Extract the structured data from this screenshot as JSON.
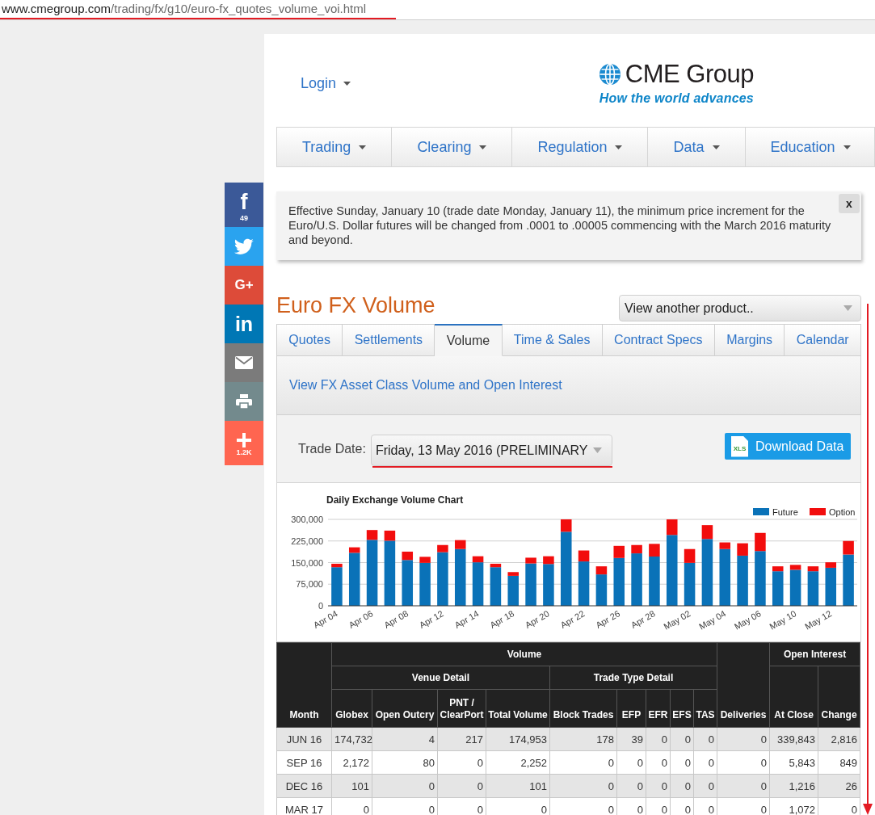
{
  "browser": {
    "url_domain": "www.cmegroup.com",
    "url_path": "/trading/fx/g10/euro-fx_quotes_volume_voi.html"
  },
  "social": [
    {
      "kind": "facebook",
      "glyph": "f",
      "count": "49"
    },
    {
      "kind": "twitter"
    },
    {
      "kind": "google_plus",
      "glyph": "G+"
    },
    {
      "kind": "linkedin",
      "glyph": "in"
    },
    {
      "kind": "email"
    },
    {
      "kind": "print"
    },
    {
      "kind": "share",
      "count": "1.2K"
    }
  ],
  "header": {
    "login": "Login",
    "logo_name": "CME Group",
    "tagline": "How the world advances"
  },
  "nav": [
    {
      "label": "Trading"
    },
    {
      "label": "Clearing"
    },
    {
      "label": "Regulation"
    },
    {
      "label": "Data"
    },
    {
      "label": "Education"
    }
  ],
  "notice": {
    "text": "Effective Sunday, January 10 (trade date Monday, January 11), the minimum price increment for the Euro/U.S. Dollar futures will be changed from .0001 to .00005 commencing with the March 2016 maturity and beyond.",
    "close": "x"
  },
  "product": {
    "title": "Euro FX Volume",
    "selector": "View another product.."
  },
  "tabs": [
    {
      "label": "Quotes",
      "selected": false
    },
    {
      "label": "Settlements",
      "selected": false
    },
    {
      "label": "Volume",
      "selected": true
    },
    {
      "label": "Time & Sales",
      "selected": false
    },
    {
      "label": "Contract Specs",
      "selected": false
    },
    {
      "label": "Margins",
      "selected": false
    },
    {
      "label": "Calendar",
      "selected": false
    }
  ],
  "volume_link": "View FX Asset Class Volume and Open Interest",
  "trade_date": {
    "label": "Trade Date:",
    "value": "Friday, 13 May 2016 (PRELIMINARY"
  },
  "download": {
    "label": "Download Data",
    "file_type": "XLS"
  },
  "chart": {
    "chart_data": {
      "type": "bar",
      "title": "Daily Exchange Volume Chart",
      "stacked": true,
      "grid": true,
      "legend": true,
      "ylim": [
        0,
        300000
      ],
      "yticks": [
        {
          "value": 0,
          "label": "0"
        },
        {
          "value": 75000,
          "label": "75,000"
        },
        {
          "value": 150000,
          "label": "150,000"
        },
        {
          "value": 225000,
          "label": "225,000"
        },
        {
          "value": 300000,
          "label": "300,000"
        }
      ],
      "categories": [
        "Apr 04",
        null,
        "Apr 06",
        null,
        "Apr 08",
        null,
        "Apr 12",
        null,
        "Apr 14",
        null,
        "Apr 18",
        null,
        "Apr 20",
        null,
        "Apr 22",
        null,
        "Apr 26",
        null,
        "Apr 28",
        null,
        "May 02",
        null,
        "May 04",
        null,
        "May 06",
        null,
        "May 10",
        null,
        "May 12",
        null
      ],
      "series": [
        {
          "name": "Future",
          "color": "#0a72b8",
          "values": [
            134000,
            184000,
            229000,
            226000,
            159000,
            149000,
            186000,
            197000,
            151000,
            134000,
            104000,
            147000,
            145000,
            257000,
            154000,
            109000,
            166000,
            182000,
            171000,
            246000,
            149000,
            232000,
            197000,
            174000,
            190000,
            120000,
            125000,
            120000,
            132000,
            178000
          ]
        },
        {
          "name": "Option",
          "color": "#f20d0d",
          "values": [
            12000,
            19000,
            34000,
            35000,
            29000,
            21000,
            25000,
            31000,
            21000,
            12000,
            13000,
            20000,
            27000,
            43000,
            38000,
            28000,
            42000,
            29000,
            44000,
            54000,
            48000,
            48000,
            23000,
            43000,
            63000,
            17000,
            17000,
            17000,
            19000,
            47000
          ]
        }
      ]
    }
  },
  "table": {
    "columns": [
      {
        "label": "Month"
      },
      {
        "label": "Volume",
        "children": [
          {
            "label": "Venue Detail",
            "children": [
              {
                "label": "Globex"
              },
              {
                "label": "Open Outcry"
              },
              {
                "label": "PNT / ClearPort"
              },
              {
                "label": "Total Volume"
              }
            ]
          },
          {
            "label": "Trade Type Detail",
            "children": [
              {
                "label": "Block Trades"
              },
              {
                "label": "EFP"
              },
              {
                "label": "EFR"
              },
              {
                "label": "EFS"
              },
              {
                "label": "TAS"
              }
            ]
          }
        ]
      },
      {
        "label": "Deliveries"
      },
      {
        "label": "Open Interest",
        "children": [
          {
            "label": "At Close"
          },
          {
            "label": "Change"
          }
        ]
      }
    ],
    "rows": [
      {
        "month": "JUN 16",
        "values": [
          "174,732",
          "4",
          "217",
          "174,953",
          "178",
          "39",
          "0",
          "0",
          "0",
          "0",
          "339,843",
          "2,816"
        ]
      },
      {
        "month": "SEP 16",
        "values": [
          "2,172",
          "80",
          "0",
          "2,252",
          "0",
          "0",
          "0",
          "0",
          "0",
          "0",
          "5,843",
          "849"
        ]
      },
      {
        "month": "DEC 16",
        "values": [
          "101",
          "0",
          "0",
          "101",
          "0",
          "0",
          "0",
          "0",
          "0",
          "0",
          "1,216",
          "26"
        ]
      },
      {
        "month": "MAR 17",
        "values": [
          "0",
          "0",
          "0",
          "0",
          "0",
          "0",
          "0",
          "0",
          "0",
          "0",
          "1,072",
          "0"
        ]
      }
    ]
  }
}
